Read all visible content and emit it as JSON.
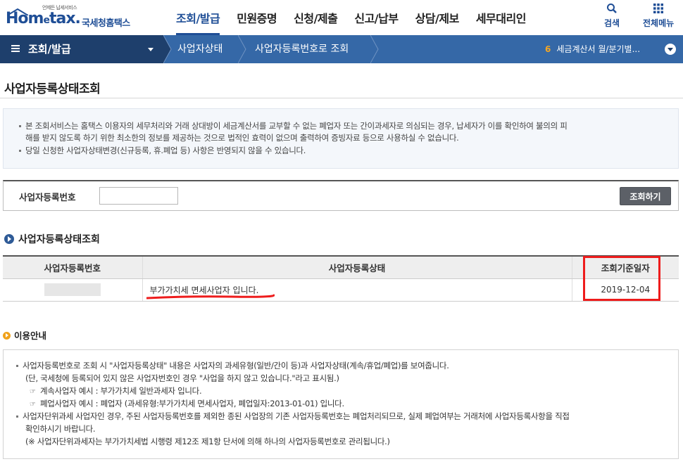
{
  "header": {
    "logo_sub": "언제든 납세서비스",
    "logo_main_1": "Hom",
    "logo_main_e": "e",
    "logo_main_2": "tax.",
    "logo_kr": "국세청홈택스",
    "nav": [
      "조회/발급",
      "민원증명",
      "신청/제출",
      "신고/납부",
      "상담/제보",
      "세무대리인"
    ],
    "active_nav": 0,
    "search_label": "검색",
    "all_menu_label": "전체메뉴",
    "brand_color": "#1f4e96"
  },
  "location": {
    "menu_title": "조회/발급",
    "crumbs": [
      "사업자상태",
      "사업자등록번호로 조회"
    ],
    "right_num": "6",
    "right_text": "세금계산서 월/분기별..."
  },
  "page": {
    "title": "사업자등록상태조회"
  },
  "notice": {
    "lines": [
      "본 조회서비스는 홈택스 이용자의 세무처리와 거래 상대방이 세금계산서를 교부할 수 없는 폐업자 또는 간이과세자로 의심되는 경우, 납세자가 이를 확인하여 불의의 피",
      "해를 받지 않도록 하기 위한 최소한의 정보를 제공하는 것으로 법적인 효력이 없으며 출력하여 증빙자료 등으로 사용하실 수 없습니다.",
      "당일 신청한 사업자상태변경(신규등록, 휴.폐업 등) 사항은 반영되지 않을 수 있습니다."
    ]
  },
  "search": {
    "label": "사업자등록번호",
    "value": "",
    "button": "조회하기"
  },
  "result": {
    "heading": "사업자등록상태조회",
    "columns": [
      "사업자등록번호",
      "사업자등록상태",
      "조회기준일자"
    ],
    "rows": [
      {
        "status": "부가가치세 면세사업자 입니다.",
        "date": "2019-12-04"
      }
    ]
  },
  "guide": {
    "heading": "이용안내",
    "lines": [
      "사업자등록번호로 조회 시 \"사업자등록상태\" 내용은 사업자의 과세유형(일반/간이 등)과 사업자상태(계속/휴업/폐업)를 보여줍니다.",
      "(단, 국세청에 등록되어 있지 않은 사업자번호인 경우 \"사업을 하지 않고 있습니다.\"라고 표시됨.)",
      "계속사업자 예시 : 부가가치세 일반과세자 입니다.",
      "폐업사업자 예시 : 폐업자 (과세유형:부가가치세 면세사업자, 폐업일자:2013-01-01) 입니다.",
      "사업자단위과세 사업자인 경우, 주된 사업자등록번호를 제외한 종된 사업장의 기존 사업자등록번호는 폐업처리되므로, 실제 폐업여부는 거래처에 사업자등록사항을 직접",
      "확인하시기 바랍니다.",
      "(※ 사업자단위과세자는 부가가치세법 시행령 제12조 제1항 단서에 의해 하나의 사업자등록번호로 관리됩니다.)"
    ]
  },
  "annotation_color": "#ee1c1c"
}
